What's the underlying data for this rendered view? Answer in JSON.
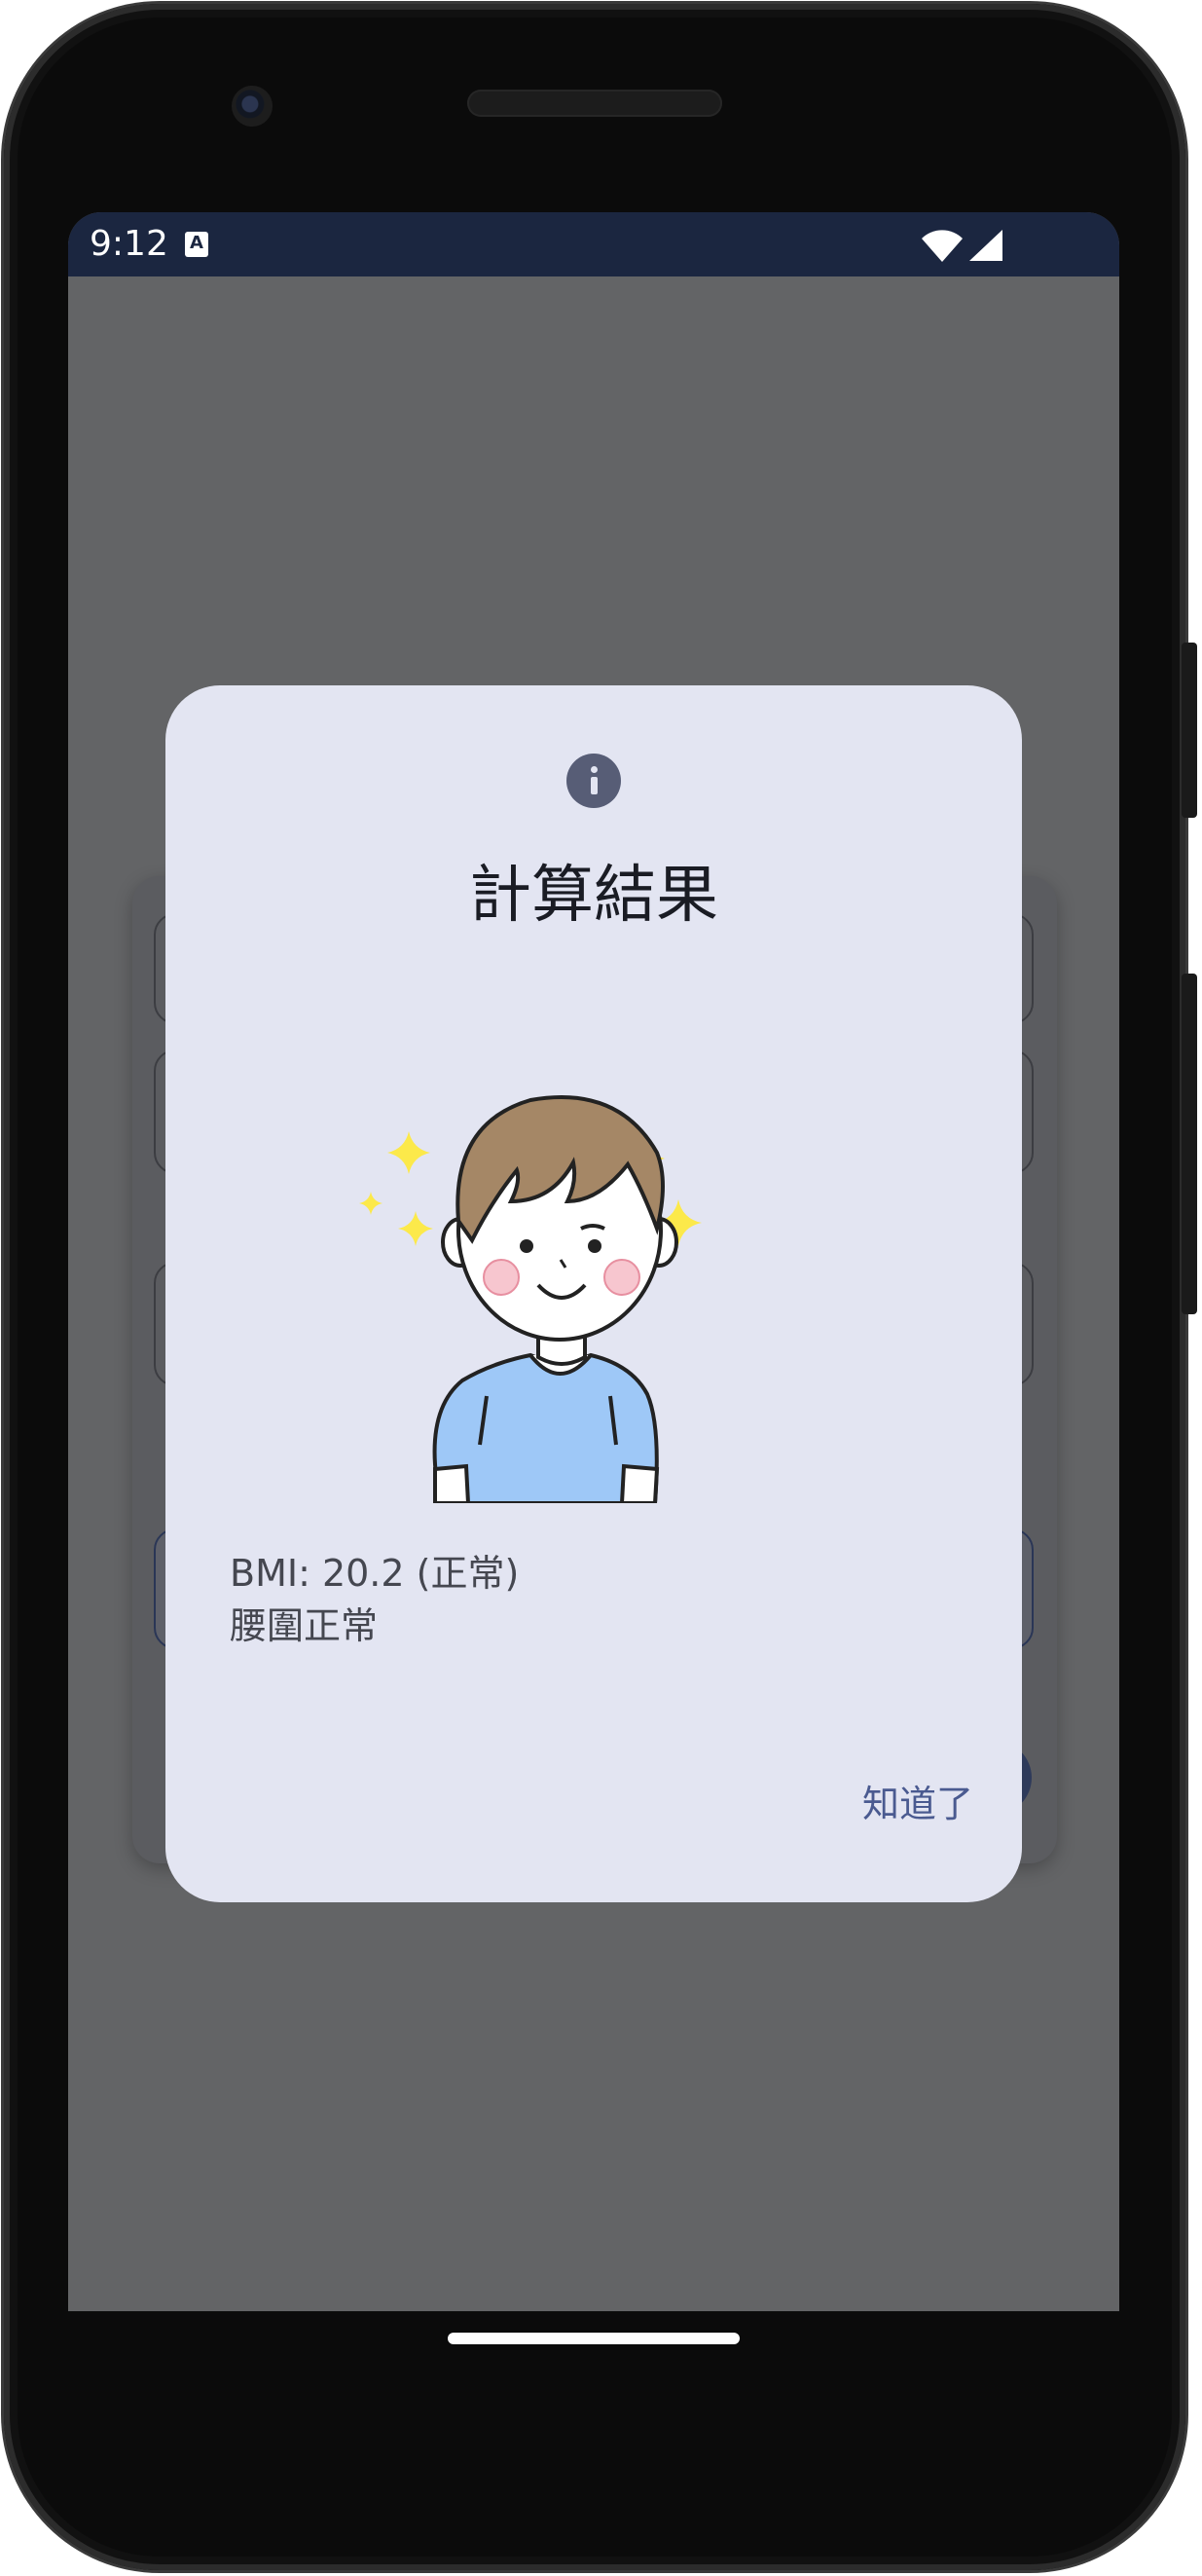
{
  "status_bar": {
    "time": "9:12",
    "notification_icon": "keyboard-a-icon",
    "icons": [
      "wifi-icon",
      "cellular-signal-icon"
    ]
  },
  "dialog": {
    "icon": "info-icon",
    "title": "計算結果",
    "illustration": "smiling-boy-with-sparkles",
    "results": {
      "bmi": "BMI: 20.2 (正常)",
      "waist": "腰圍正常"
    },
    "confirm_label": "知道了"
  },
  "colors": {
    "status_bar_bg": "#1b2640",
    "scrim": "#636466",
    "dialog_bg": "#e3e5f2",
    "accent": "#4a5a90",
    "icon_bg": "#575d76",
    "shirt": "#9ec8f7",
    "hair": "#a58766",
    "sparkle": "#fce94a"
  }
}
